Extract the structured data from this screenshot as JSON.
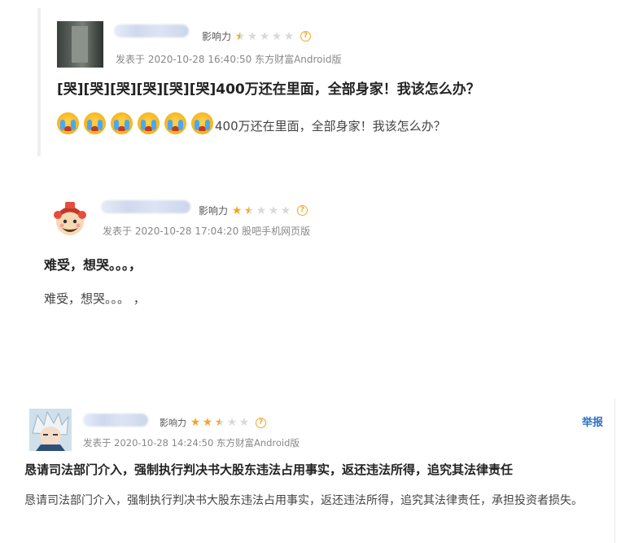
{
  "post1": {
    "influence_label": "影响力",
    "help_icon": "question-circle-icon",
    "meta": "发表于 2020-10-28 16:40:50 东方财富Android版",
    "title": "[哭][哭][哭][哭][哭][哭]400万还在里面，全部身家！我该怎么办？",
    "emoji_name": "crying-face-emoji",
    "emoji_count": 6,
    "body_text": "400万还在里面，全部身家！我该怎么办？",
    "rating": 1
  },
  "post2": {
    "influence_label": "影响力",
    "meta": "发表于 2020-10-28 17:04:20 股吧手机网页版",
    "title": "难受，想哭。。。，",
    "body_text": "难受，想哭。。。  ，",
    "rating": 1.5
  },
  "post3": {
    "influence_label": "影响力",
    "meta": "发表于 2020-10-28 14:24:50 东方财富Android版",
    "report_label": "举报",
    "title": "恳请司法部门介入，强制执行判决书大股东违法占用事实，返还违法所得，追究其法律责任",
    "body_text": "恳请司法部门介入，强制执行判决书大股东违法占用事实，返还违法所得，追究其法律责任，承担投资者损失。",
    "rating": 2.5
  },
  "colors": {
    "star": "#f5a623",
    "link": "#2a6fc9"
  }
}
